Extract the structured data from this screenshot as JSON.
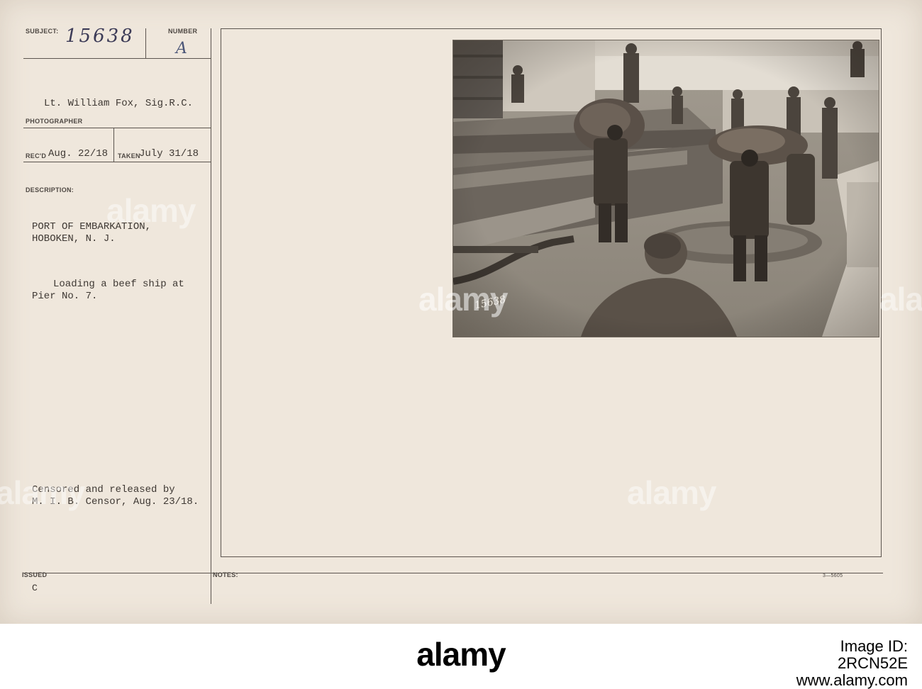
{
  "card": {
    "subject_label": "SUBJECT:",
    "subject_value": "15638",
    "number_label": "NUMBER",
    "number_value": "A",
    "photographer_value": "Lt. William Fox, Sig.R.C.",
    "photographer_label": "PHOTOGRAPHER",
    "recd_label": "REC'D",
    "recd_value": "Aug. 22/18",
    "taken_label": "TAKEN",
    "taken_value": "July 31/18",
    "description_label": "DESCRIPTION:",
    "description_heading_1": "PORT OF EMBARKATION,",
    "description_heading_2": "HOBOKEN, N. J.",
    "description_body_1": "Loading a beef ship at",
    "description_body_2": "Pier No. 7.",
    "censor_1": "Censored and released by",
    "censor_2": "M. I. B. Censor, Aug. 23/18.",
    "issued_label": "ISSUED",
    "issued_value": "C",
    "notes_label": "NOTES:",
    "form_code": "3—5605"
  },
  "photo": {
    "negative_number": "15638"
  },
  "watermarks": [
    "alamy",
    "alamy",
    "alamy",
    "alamy",
    "alamy"
  ],
  "stock": {
    "logo": "alamy",
    "image_id_line1": "Image ID: 2RCN52E",
    "image_id_line2": "www.alamy.com"
  }
}
